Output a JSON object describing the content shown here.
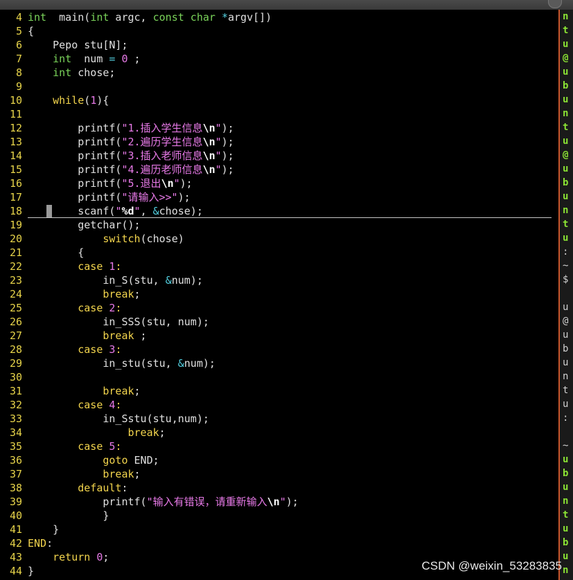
{
  "watermark": "CSDN @weixin_53283835",
  "lines": [
    {
      "n": "4",
      "segs": [
        [
          "ty",
          "int"
        ],
        [
          "",
          "  main("
        ],
        [
          "ty",
          "int"
        ],
        [
          "",
          " argc, "
        ],
        [
          "ty",
          "const char"
        ],
        [
          "",
          " "
        ],
        [
          "op",
          "*"
        ],
        [
          "",
          "argv[])"
        ]
      ]
    },
    {
      "n": "5",
      "segs": [
        [
          "",
          "{"
        ]
      ]
    },
    {
      "n": "6",
      "segs": [
        [
          "",
          "    Pepo stu[N];"
        ]
      ]
    },
    {
      "n": "7",
      "segs": [
        [
          "",
          "    "
        ],
        [
          "ty",
          "int"
        ],
        [
          "",
          "  num "
        ],
        [
          "op",
          "="
        ],
        [
          "",
          " "
        ],
        [
          "num",
          "0"
        ],
        [
          "",
          " ;"
        ]
      ]
    },
    {
      "n": "8",
      "segs": [
        [
          "",
          "    "
        ],
        [
          "ty",
          "int"
        ],
        [
          "",
          " chose;"
        ]
      ]
    },
    {
      "n": "9",
      "segs": [
        [
          "",
          ""
        ]
      ]
    },
    {
      "n": "10",
      "segs": [
        [
          "",
          "    "
        ],
        [
          "kw",
          "while"
        ],
        [
          "",
          "("
        ],
        [
          "num",
          "1"
        ],
        [
          "",
          "){"
        ]
      ]
    },
    {
      "n": "11",
      "segs": [
        [
          "",
          ""
        ]
      ]
    },
    {
      "n": "12",
      "segs": [
        [
          "",
          "        printf("
        ],
        [
          "str",
          "\"1.插入学生信息"
        ],
        [
          "esc",
          "\\n"
        ],
        [
          "str",
          "\""
        ],
        [
          "",
          ");"
        ]
      ]
    },
    {
      "n": "13",
      "segs": [
        [
          "",
          "        printf("
        ],
        [
          "str",
          "\"2.遍历学生信息"
        ],
        [
          "esc",
          "\\n"
        ],
        [
          "str",
          "\""
        ],
        [
          "",
          ");"
        ]
      ]
    },
    {
      "n": "14",
      "segs": [
        [
          "",
          "        printf("
        ],
        [
          "str",
          "\"3.插入老师信息"
        ],
        [
          "esc",
          "\\n"
        ],
        [
          "str",
          "\""
        ],
        [
          "",
          ");"
        ]
      ]
    },
    {
      "n": "15",
      "segs": [
        [
          "",
          "        printf("
        ],
        [
          "str",
          "\"4.遍历老师信息"
        ],
        [
          "esc",
          "\\n"
        ],
        [
          "str",
          "\""
        ],
        [
          "",
          ");"
        ]
      ]
    },
    {
      "n": "16",
      "segs": [
        [
          "",
          "        printf("
        ],
        [
          "str",
          "\"5.退出"
        ],
        [
          "esc",
          "\\n"
        ],
        [
          "str",
          "\""
        ],
        [
          "",
          ");"
        ]
      ]
    },
    {
      "n": "17",
      "segs": [
        [
          "",
          "        printf("
        ],
        [
          "str",
          "\"请输入>>\""
        ],
        [
          "",
          ");"
        ]
      ]
    },
    {
      "n": "18",
      "segs": [
        [
          "",
          "        scanf("
        ],
        [
          "str",
          "\""
        ],
        [
          "esc",
          "%d"
        ],
        [
          "str",
          "\""
        ],
        [
          "",
          ", "
        ],
        [
          "op",
          "&"
        ],
        [
          "",
          "chose);"
        ]
      ]
    },
    {
      "n": "19",
      "segs": [
        [
          "",
          "        getchar();"
        ]
      ]
    },
    {
      "n": "20",
      "segs": [
        [
          "",
          "            "
        ],
        [
          "kw",
          "switch"
        ],
        [
          "",
          "(chose)"
        ]
      ]
    },
    {
      "n": "21",
      "segs": [
        [
          "",
          "        {"
        ]
      ]
    },
    {
      "n": "22",
      "segs": [
        [
          "",
          "        "
        ],
        [
          "kw",
          "case"
        ],
        [
          "",
          " "
        ],
        [
          "num",
          "1"
        ],
        [
          "kw",
          ":"
        ]
      ]
    },
    {
      "n": "23",
      "segs": [
        [
          "",
          "            in_S(stu, "
        ],
        [
          "op",
          "&"
        ],
        [
          "",
          "num);"
        ]
      ]
    },
    {
      "n": "24",
      "segs": [
        [
          "",
          "            "
        ],
        [
          "kw",
          "break"
        ],
        [
          "",
          ";"
        ]
      ]
    },
    {
      "n": "25",
      "segs": [
        [
          "",
          "        "
        ],
        [
          "kw",
          "case"
        ],
        [
          "",
          " "
        ],
        [
          "num",
          "2"
        ],
        [
          "kw",
          ":"
        ]
      ]
    },
    {
      "n": "26",
      "segs": [
        [
          "",
          "            in_SSS(stu, num);"
        ]
      ]
    },
    {
      "n": "27",
      "segs": [
        [
          "",
          "            "
        ],
        [
          "kw",
          "break"
        ],
        [
          "",
          " ;"
        ]
      ]
    },
    {
      "n": "28",
      "segs": [
        [
          "",
          "        "
        ],
        [
          "kw",
          "case"
        ],
        [
          "",
          " "
        ],
        [
          "num",
          "3"
        ],
        [
          "kw",
          ":"
        ]
      ]
    },
    {
      "n": "29",
      "segs": [
        [
          "",
          "            in_stu(stu, "
        ],
        [
          "op",
          "&"
        ],
        [
          "",
          "num);"
        ]
      ]
    },
    {
      "n": "30",
      "segs": [
        [
          "",
          ""
        ]
      ]
    },
    {
      "n": "31",
      "segs": [
        [
          "",
          "            "
        ],
        [
          "kw",
          "break"
        ],
        [
          "",
          ";"
        ]
      ]
    },
    {
      "n": "32",
      "segs": [
        [
          "",
          "        "
        ],
        [
          "kw",
          "case"
        ],
        [
          "",
          " "
        ],
        [
          "num",
          "4"
        ],
        [
          "kw",
          ":"
        ]
      ]
    },
    {
      "n": "33",
      "segs": [
        [
          "",
          "            in_Sstu(stu,num);"
        ]
      ]
    },
    {
      "n": "34",
      "segs": [
        [
          "",
          "                "
        ],
        [
          "kw",
          "break"
        ],
        [
          "",
          ";"
        ]
      ]
    },
    {
      "n": "35",
      "segs": [
        [
          "",
          "        "
        ],
        [
          "kw",
          "case"
        ],
        [
          "",
          " "
        ],
        [
          "num",
          "5"
        ],
        [
          "kw",
          ":"
        ]
      ]
    },
    {
      "n": "36",
      "segs": [
        [
          "",
          "            "
        ],
        [
          "kw",
          "goto"
        ],
        [
          "",
          " END;"
        ]
      ]
    },
    {
      "n": "37",
      "segs": [
        [
          "",
          "            "
        ],
        [
          "kw",
          "break"
        ],
        [
          "",
          ";"
        ]
      ]
    },
    {
      "n": "38",
      "segs": [
        [
          "",
          "        "
        ],
        [
          "kw",
          "default"
        ],
        [
          "",
          ":"
        ]
      ]
    },
    {
      "n": "39",
      "segs": [
        [
          "",
          "            printf("
        ],
        [
          "str",
          "\"输入有错误，请重新输入"
        ],
        [
          "esc",
          "\\n"
        ],
        [
          "str",
          "\""
        ],
        [
          "",
          ");"
        ]
      ]
    },
    {
      "n": "40",
      "segs": [
        [
          "",
          "            }"
        ]
      ]
    },
    {
      "n": "41",
      "segs": [
        [
          "",
          "    }"
        ]
      ]
    },
    {
      "n": "42",
      "segs": [
        [
          "lbl",
          "END"
        ],
        [
          "",
          ":"
        ]
      ]
    },
    {
      "n": "43",
      "segs": [
        [
          "",
          "    "
        ],
        [
          "kw",
          "return"
        ],
        [
          "",
          " "
        ],
        [
          "num",
          "0"
        ],
        [
          "",
          ";"
        ]
      ]
    },
    {
      "n": "44",
      "segs": [
        [
          "",
          "}"
        ]
      ]
    }
  ],
  "sidebar_chars": [
    [
      "g",
      "n"
    ],
    [
      "g",
      "t"
    ],
    [
      "g",
      "u"
    ],
    [
      "g",
      "@"
    ],
    [
      "g",
      "u"
    ],
    [
      "g",
      "b"
    ],
    [
      "g",
      "u"
    ],
    [
      "g",
      "n"
    ],
    [
      "g",
      "t"
    ],
    [
      "g",
      "u"
    ],
    [
      "g",
      "@"
    ],
    [
      "g",
      "u"
    ],
    [
      "g",
      "b"
    ],
    [
      "g",
      "u"
    ],
    [
      "g",
      "n"
    ],
    [
      "g",
      "t"
    ],
    [
      "g",
      "u"
    ],
    [
      "w",
      ":"
    ],
    [
      "w",
      "~"
    ],
    [
      "w",
      "$"
    ],
    [
      "w",
      ""
    ],
    [
      "w",
      "u"
    ],
    [
      "w",
      "@"
    ],
    [
      "w",
      "u"
    ],
    [
      "w",
      "b"
    ],
    [
      "w",
      "u"
    ],
    [
      "w",
      "n"
    ],
    [
      "w",
      "t"
    ],
    [
      "w",
      "u"
    ],
    [
      "w",
      ":"
    ],
    [
      "w",
      ""
    ],
    [
      "w",
      "~"
    ],
    [
      "g",
      "u"
    ],
    [
      "g",
      "b"
    ],
    [
      "g",
      "u"
    ],
    [
      "g",
      "n"
    ],
    [
      "g",
      "t"
    ],
    [
      "g",
      "u"
    ],
    [
      "g",
      "b"
    ],
    [
      "g",
      "u"
    ],
    [
      "g",
      "n"
    ]
  ]
}
